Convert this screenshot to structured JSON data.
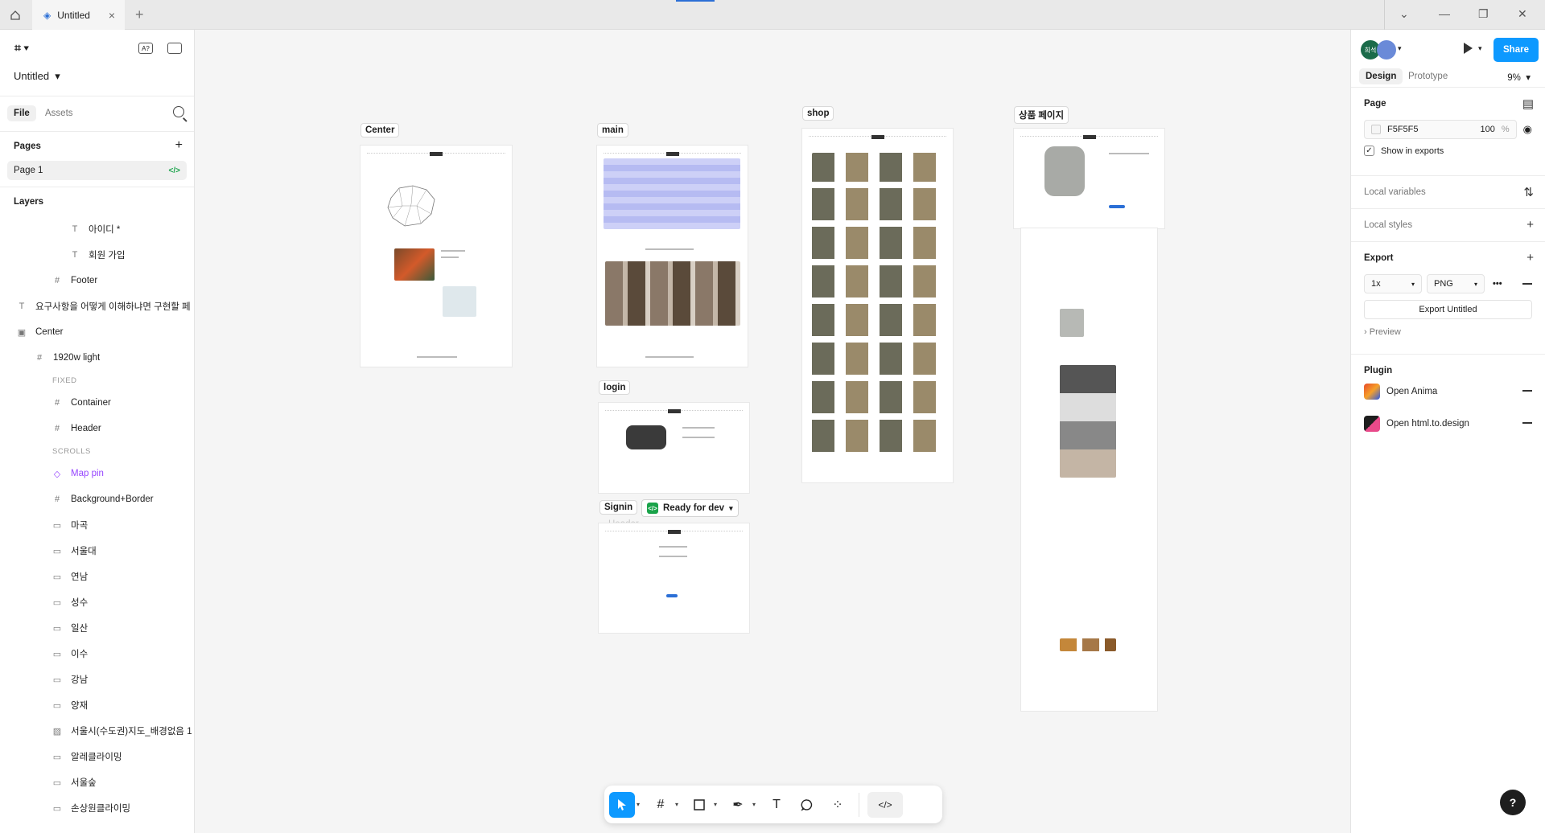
{
  "titlebar": {
    "tab_title": "Untitled",
    "close_icon": "×",
    "new_tab": "+",
    "win_controls": [
      "⌄",
      "—",
      "❐",
      "✕"
    ]
  },
  "left_panel": {
    "file_name": "Untitled",
    "tabs": [
      "File",
      "Assets"
    ],
    "pages_title": "Pages",
    "pages": [
      {
        "name": "Page 1",
        "badge": "</>"
      }
    ],
    "layers_title": "Layers",
    "layers": [
      {
        "name": "아이디 *",
        "glyph": "T",
        "indent": 3
      },
      {
        "name": "회원 가입",
        "glyph": "T",
        "indent": 3
      },
      {
        "name": "Footer",
        "glyph": "#",
        "indent": 2
      },
      {
        "name": "요구사항을 어떻게 이해하냐면 구현할 페",
        "glyph": "T",
        "indent": 0
      },
      {
        "name": "Center",
        "glyph": "▣",
        "indent": 0,
        "bold": true
      },
      {
        "name": "1920w light",
        "glyph": "#",
        "indent": 1
      },
      {
        "label": "FIXED"
      },
      {
        "name": "Container",
        "glyph": "#",
        "indent": 2
      },
      {
        "name": "Header",
        "glyph": "#",
        "indent": 2
      },
      {
        "label": "SCROLLS"
      },
      {
        "name": "Map pin",
        "glyph": "◇",
        "indent": 2,
        "purple": true
      },
      {
        "name": "Background+Border",
        "glyph": "#",
        "indent": 2
      },
      {
        "name": "마곡",
        "glyph": "▭",
        "indent": 2
      },
      {
        "name": "서울대",
        "glyph": "▭",
        "indent": 2
      },
      {
        "name": "연남",
        "glyph": "▭",
        "indent": 2
      },
      {
        "name": "성수",
        "glyph": "▭",
        "indent": 2
      },
      {
        "name": "일산",
        "glyph": "▭",
        "indent": 2
      },
      {
        "name": "이수",
        "glyph": "▭",
        "indent": 2
      },
      {
        "name": "강남",
        "glyph": "▭",
        "indent": 2
      },
      {
        "name": "양재",
        "glyph": "▭",
        "indent": 2
      },
      {
        "name": "서울시(수도권)지도_배경없음 1",
        "glyph": "▨",
        "indent": 2
      },
      {
        "name": "알레클라이밍",
        "glyph": "▭",
        "indent": 2
      },
      {
        "name": "서울숲",
        "glyph": "▭",
        "indent": 2
      },
      {
        "name": "손상원클라이밍",
        "glyph": "▭",
        "indent": 2
      }
    ]
  },
  "canvas": {
    "frames": [
      {
        "label": "Center"
      },
      {
        "label": "main"
      },
      {
        "label": "shop"
      },
      {
        "label": "상품 페이지"
      },
      {
        "label": "login"
      },
      {
        "label": "Signin"
      }
    ],
    "ghost_header": "Header",
    "ready_chip": "Ready for dev",
    "ready_chip_icon": "</>"
  },
  "right_panel": {
    "avatar_initials": "희석",
    "share_label": "Share",
    "tabs": [
      "Design",
      "Prototype"
    ],
    "zoom": "9%",
    "page_section": "Page",
    "bg_color": "F5F5F5",
    "bg_opacity": "100",
    "opacity_unit": "%",
    "show_in_exports": "Show in exports",
    "local_variables": "Local variables",
    "local_styles": "Local styles",
    "export_title": "Export",
    "export_scale": "1x",
    "export_format": "PNG",
    "export_button": "Export Untitled",
    "preview": "Preview",
    "plugin_title": "Plugin",
    "plugins": [
      "Open Anima",
      "Open html.to.design"
    ]
  },
  "toolbar": {
    "tools": [
      "move-tool",
      "frame-tool",
      "shape-tool",
      "pen-tool",
      "text-tool",
      "comment-tool",
      "actions-tool",
      "dev-mode-toggle"
    ]
  },
  "help_label": "?"
}
